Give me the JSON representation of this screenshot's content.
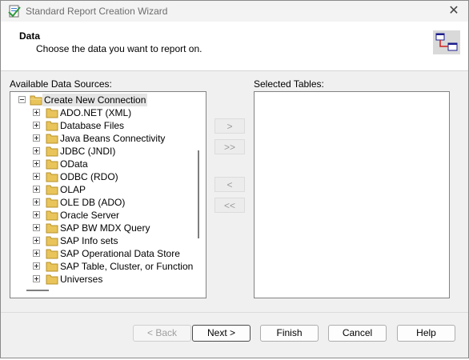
{
  "window": {
    "title": "Standard Report Creation Wizard",
    "close_glyph": "✕"
  },
  "header": {
    "title": "Data",
    "subtitle": "Choose the data you want to report on."
  },
  "available": {
    "label": "Available Data Sources:",
    "root": "Create New Connection",
    "items": [
      "ADO.NET (XML)",
      "Database Files",
      "Java Beans Connectivity",
      "JDBC (JNDI)",
      "OData",
      "ODBC (RDO)",
      "OLAP",
      "OLE DB (ADO)",
      "Oracle Server",
      "SAP BW MDX Query",
      "SAP Info sets",
      "SAP Operational Data Store",
      "SAP Table, Cluster, or Function",
      "Universes"
    ]
  },
  "selected": {
    "label": "Selected Tables:"
  },
  "move_buttons": {
    "add": ">",
    "add_all": ">>",
    "remove": "<",
    "remove_all": "<<"
  },
  "buttons": {
    "back": "< Back",
    "next": "Next >",
    "finish": "Finish",
    "cancel": "Cancel",
    "help": "Help"
  },
  "colors": {
    "folder": "#e8c45a",
    "folder_edge": "#b8922a",
    "selection": "#e5e5e5"
  }
}
